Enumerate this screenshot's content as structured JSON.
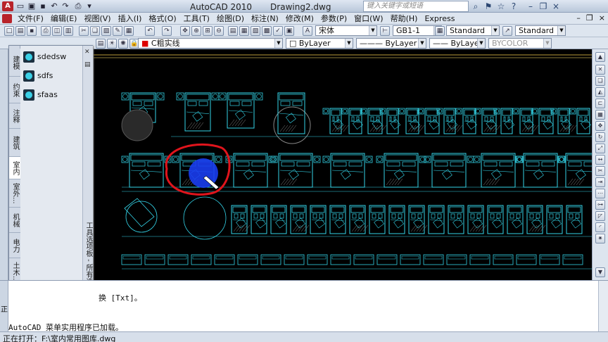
{
  "window": {
    "app_title": "AutoCAD 2010",
    "doc_title": "Drawing2.dwg",
    "search_placeholder": "键入关键字或短语"
  },
  "menubar": {
    "items": [
      "文件(F)",
      "编辑(E)",
      "视图(V)",
      "插入(I)",
      "格式(O)",
      "工具(T)",
      "绘图(D)",
      "标注(N)",
      "修改(M)",
      "参数(P)",
      "窗口(W)",
      "帮助(H)",
      "Express"
    ]
  },
  "toolbar1": {
    "font_combo": "宋体",
    "dimstyle_combo": "GB1-1",
    "tablestyle_combo": "Standard",
    "mleader_combo": "Standard"
  },
  "toolbar2": {
    "layer_combo": "C粗实线",
    "color_combo": "ByLayer",
    "linetype_combo": "ByLayer",
    "lineweight_combo": "ByLayer",
    "plotstyle_combo": "BYCOLOR"
  },
  "left_strip": {
    "items": [
      "建模",
      "约束",
      "注释",
      "建筑",
      "室内",
      "室外",
      "机械",
      "电力",
      "土木..."
    ]
  },
  "palette": {
    "active_tab": "室内",
    "tabs": [
      "建模",
      "约束",
      "注释",
      "建筑",
      "室内",
      "室外...",
      "机械",
      "电力",
      "土木..."
    ],
    "items": [
      {
        "label": "sdedsw",
        "icon": "bed-block-icon"
      },
      {
        "label": "sdfs",
        "icon": "bed-block-icon"
      },
      {
        "label": "sfaas",
        "icon": "bed-block-icon"
      }
    ],
    "caption": "工具选项板 - 所有选项板"
  },
  "command": {
    "line1": "换 [Txt]。",
    "line2": "AutoCAD 菜单实用程序已加载。",
    "left_label": "正"
  },
  "status": {
    "text": "正在打开：F:\\室内常用图库.dwg"
  },
  "colors": {
    "canvas_bg": "#000000",
    "block_lines": "#34d4e8",
    "annotation": "#e0141c",
    "highlight": "#1a3df0"
  }
}
